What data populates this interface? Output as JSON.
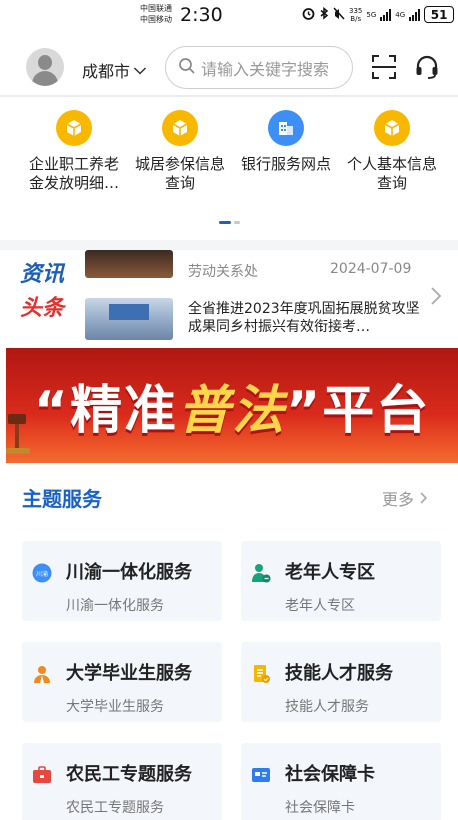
{
  "status_bar": {
    "carrier_1": "中国联通",
    "carrier_2": "中国移动",
    "time": "2:30",
    "net_speed": "335",
    "net_unit": "B/s",
    "net_type_1": "5G",
    "net_type_2": "4G",
    "battery": "51"
  },
  "header": {
    "city": "成都市",
    "search_placeholder": "请输入关键字搜索"
  },
  "quick_menu": [
    {
      "label": "企业职工养老\n金发放明细…",
      "icon": "cube-icon",
      "color": "#f9b800"
    },
    {
      "label": "城居参保信息\n查询",
      "icon": "cube-icon",
      "color": "#f9b800"
    },
    {
      "label": "银行服务网点",
      "icon": "building-icon",
      "color": "#3d8ff6"
    },
    {
      "label": "个人基本信息\n查询",
      "icon": "cube-icon",
      "color": "#f9b800"
    }
  ],
  "news": {
    "logo_line1": "资讯",
    "logo_line2": "头条",
    "item1_source": "劳动关系处",
    "item1_date": "2024-07-09",
    "item2_title": "全省推进2023年度巩固拓展脱贫攻坚成果同乡村振兴有效衔接考…"
  },
  "banner": {
    "left_quote": "“",
    "word1": "精准",
    "word2": "普法",
    "right_quote": "”",
    "word3": "平台"
  },
  "services": {
    "title": "主题服务",
    "more": "更多",
    "cards": [
      {
        "title": "川渝一体化服务",
        "subtitle": "川渝一体化服务",
        "icon": "chuanyu-icon",
        "icon_text": "川渝"
      },
      {
        "title": "老年人专区",
        "subtitle": "老年人专区",
        "icon": "elderly-icon"
      },
      {
        "title": "大学毕业生服务",
        "subtitle": "大学毕业生服务",
        "icon": "graduate-icon"
      },
      {
        "title": "技能人才服务",
        "subtitle": "技能人才服务",
        "icon": "skill-doc-icon"
      },
      {
        "title": "农民工专题服务",
        "subtitle": "农民工专题服务",
        "icon": "briefcase-icon"
      },
      {
        "title": "社会保障卡",
        "subtitle": "社会保障卡",
        "icon": "social-card-icon"
      }
    ]
  },
  "colors": {
    "accent_blue": "#1a61c6",
    "news_red": "#e0312d",
    "icon_yellow": "#f9b800",
    "banner_red": "#d82a1c"
  }
}
